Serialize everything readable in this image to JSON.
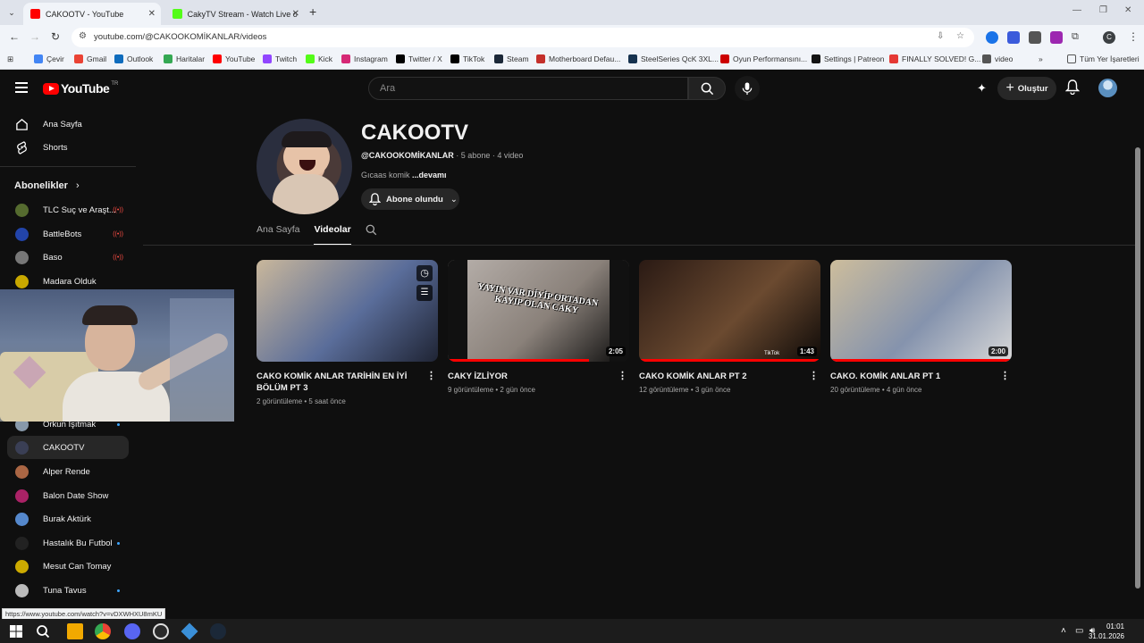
{
  "browser": {
    "tabs": [
      {
        "title": "CAKOOTV - YouTube",
        "active": true,
        "favicon_color": "#ff0000"
      },
      {
        "title": "CakyTV Stream - Watch Live on",
        "active": false,
        "favicon_color": "#53fc18"
      }
    ],
    "url": "youtube.com/@CAKOOKOMİKANLAR/videos",
    "bookmarks": [
      {
        "label": "Çevir",
        "color": "#4285f4"
      },
      {
        "label": "Gmail",
        "color": "#ea4335"
      },
      {
        "label": "Outlook",
        "color": "#0f6cbd"
      },
      {
        "label": "Haritalar",
        "color": "#34a853"
      },
      {
        "label": "YouTube",
        "color": "#ff0000"
      },
      {
        "label": "Twitch",
        "color": "#9146ff"
      },
      {
        "label": "Kick",
        "color": "#53fc18"
      },
      {
        "label": "Instagram",
        "color": "#d62976"
      },
      {
        "label": "Twitter / X",
        "color": "#000000"
      },
      {
        "label": "TikTok",
        "color": "#000000"
      },
      {
        "label": "Steam",
        "color": "#1b2838"
      },
      {
        "label": "Motherboard Defau...",
        "color": "#c4302b"
      },
      {
        "label": "SteelSeries QcK 3XL...",
        "color": "#16324f"
      },
      {
        "label": "Oyun Performansını...",
        "color": "#cc0000"
      },
      {
        "label": "Settings | Patreon",
        "color": "#141414"
      },
      {
        "label": "FINALLY SOLVED! G...",
        "color": "#e53935"
      },
      {
        "label": "video",
        "color": "#555555"
      }
    ],
    "all_bookmarks": "Tüm Yer İşaretleri",
    "more_bookmarks": "»"
  },
  "youtube": {
    "logo_text": "YouTube",
    "logo_region": "TR",
    "search_placeholder": "Ara",
    "create_label": "Oluştur",
    "sidebar": {
      "nav": [
        {
          "label": "Ana Sayfa",
          "icon": "home-icon"
        },
        {
          "label": "Shorts",
          "icon": "shorts-icon"
        }
      ],
      "subscriptions_header": "Abonelikler",
      "subscriptions": [
        {
          "label": "TLC Suç ve Araşt...",
          "badge": "live",
          "color": "#556b2f"
        },
        {
          "label": "BattleBots",
          "badge": "live",
          "color": "#2244aa"
        },
        {
          "label": "Baso",
          "badge": "live",
          "color": "#777777"
        },
        {
          "label": "Madara Olduk",
          "badge": "",
          "color": "#c8a800"
        },
        {
          "label": "Orkun Işıtmak",
          "badge": "dot",
          "color": "#8899aa"
        },
        {
          "label": "CAKOOTV",
          "badge": "",
          "color": "#3a3f55",
          "selected": true
        },
        {
          "label": "Alper Rende",
          "badge": "",
          "color": "#aa6644"
        },
        {
          "label": "Balon Date Show",
          "badge": "",
          "color": "#aa2266"
        },
        {
          "label": "Burak Aktürk",
          "badge": "",
          "color": "#5588cc"
        },
        {
          "label": "Hastalık Bu Futbol",
          "badge": "dot",
          "color": "#222222"
        },
        {
          "label": "Mesut Can Tomay",
          "badge": "",
          "color": "#ccaa00"
        },
        {
          "label": "Tuna Tavus",
          "badge": "dot",
          "color": "#bbbbbb"
        }
      ]
    },
    "channel": {
      "name": "CAKOOTV",
      "handle": "@CAKOOKOMİKANLAR",
      "subscribers": "5 abone",
      "video_count": "4 video",
      "description": "Gıcaas komik",
      "more": "...devamı",
      "subscribed_label": "Abone olundu",
      "tabs": [
        {
          "label": "Ana Sayfa",
          "selected": false
        },
        {
          "label": "Videolar",
          "selected": true
        }
      ]
    },
    "videos": [
      {
        "title": "CAKO KOMİK ANLAR TARİHİN EN İYİ BÖLÜM PT 3",
        "views": "2 görüntüleme",
        "age": "5 saat önce",
        "duration": "",
        "progress": 0.0,
        "colors": [
          "#c9b79b",
          "#5a6d9a",
          "#1f2434"
        ]
      },
      {
        "title": "CAKY İZLİYOR",
        "views": "9 görüntüleme",
        "age": "2 gün önce",
        "duration": "2:05",
        "progress": 0.78,
        "overlay_text": "YAYIN VAR DİYİP ORTADAN KAYIP OLAN CAKY",
        "colors": [
          "#b9b2ad",
          "#8a817a",
          "#0a0a0a"
        ]
      },
      {
        "title": "CAKO KOMİK ANLAR PT 2",
        "views": "12 görüntüleme",
        "age": "3 gün önce",
        "duration": "1:43",
        "progress": 1.0,
        "overlay_text": "TikTok",
        "colors": [
          "#2a1a14",
          "#6b4a30",
          "#0e0a08"
        ]
      },
      {
        "title": "CAKO. KOMİK ANLAR PT 1",
        "views": "20 görüntüleme",
        "age": "4 gün önce",
        "duration": "2:00",
        "progress": 1.0,
        "colors": [
          "#cdbd9c",
          "#8593ad",
          "#d8d8d8"
        ]
      }
    ]
  },
  "status_url": "https://www.youtube.com/watch?v=vDXWHXU8mKU",
  "taskbar": {
    "time": "01:01",
    "date": "31.01.2026"
  }
}
